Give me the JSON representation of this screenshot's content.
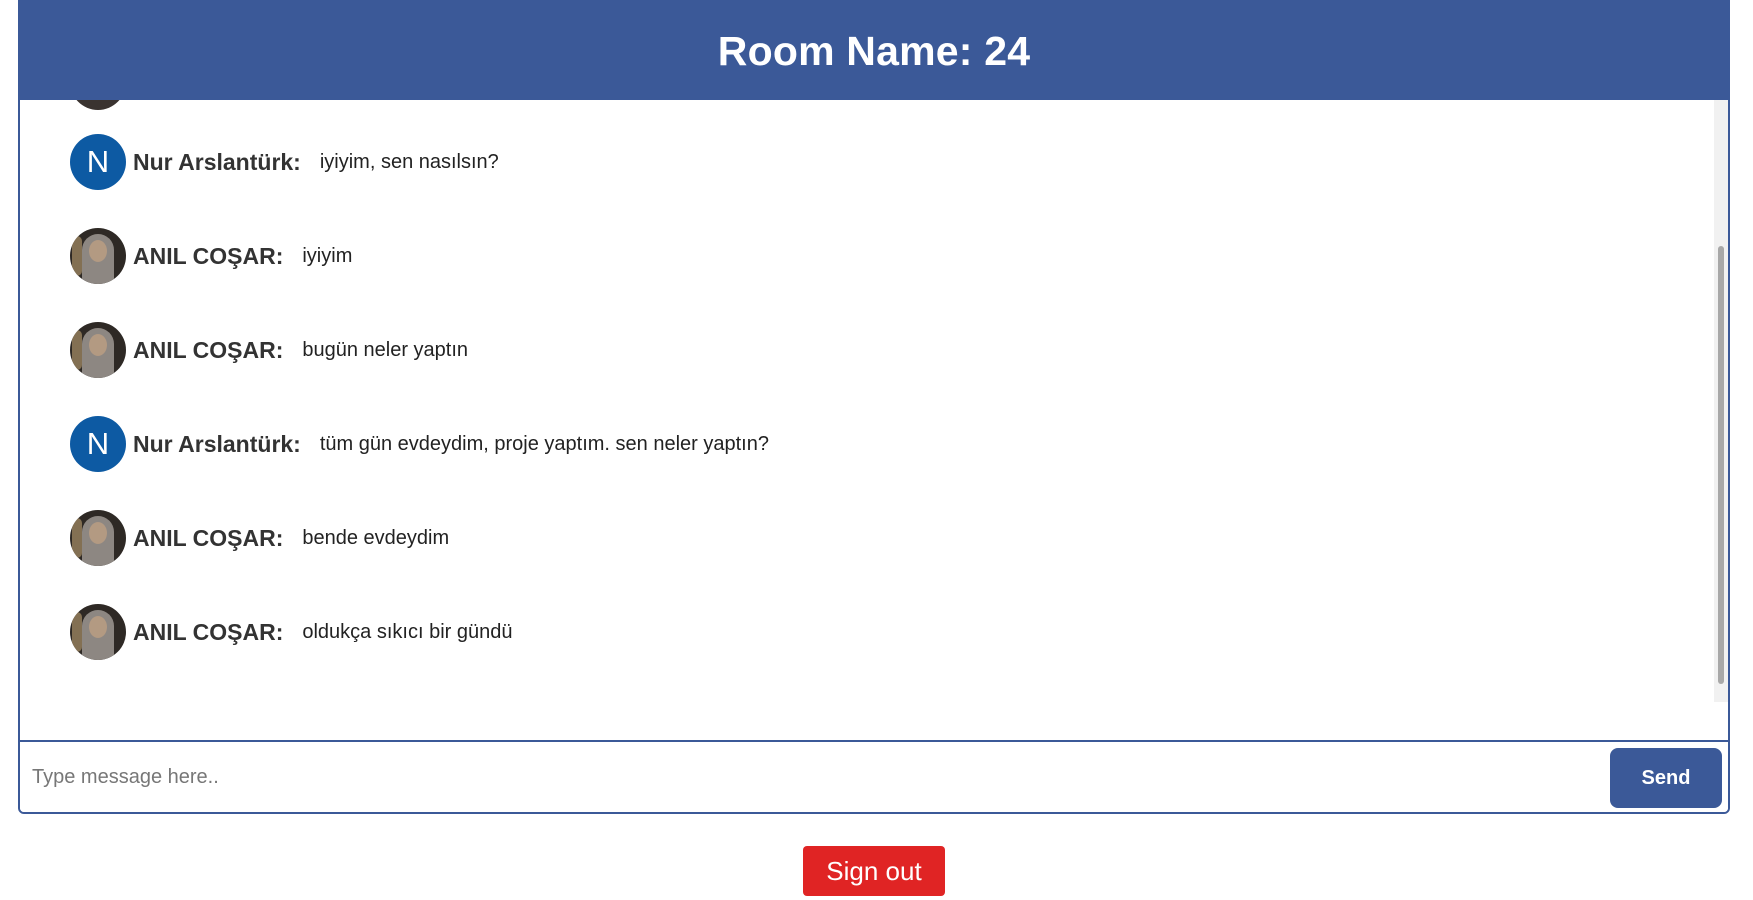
{
  "room": {
    "title": "Room Name: 24"
  },
  "messages": [
    {
      "avatar_type": "letter",
      "avatar_letter": "N",
      "sender": "Nur Arslantürk:",
      "text": "iyiyim, sen nasılsın?"
    },
    {
      "avatar_type": "photo",
      "avatar_letter": "",
      "sender": "ANIL COŞAR:",
      "text": "iyiyim"
    },
    {
      "avatar_type": "photo",
      "avatar_letter": "",
      "sender": "ANIL COŞAR:",
      "text": "bugün neler yaptın"
    },
    {
      "avatar_type": "letter",
      "avatar_letter": "N",
      "sender": "Nur Arslantürk:",
      "text": "tüm gün evdeydim, proje yaptım. sen neler yaptın?"
    },
    {
      "avatar_type": "photo",
      "avatar_letter": "",
      "sender": "ANIL COŞAR:",
      "text": "bende evdeydim"
    },
    {
      "avatar_type": "photo",
      "avatar_letter": "",
      "sender": "ANIL COŞAR:",
      "text": "oldukça sıkıcı bir gündü"
    }
  ],
  "composer": {
    "placeholder": "Type message here..",
    "value": "",
    "send_label": "Send"
  },
  "auth": {
    "signout_label": "Sign out"
  },
  "colors": {
    "header_bg": "#3b5998",
    "letter_avatar_bg": "#0d5aa3",
    "signout_bg": "#e02424"
  }
}
